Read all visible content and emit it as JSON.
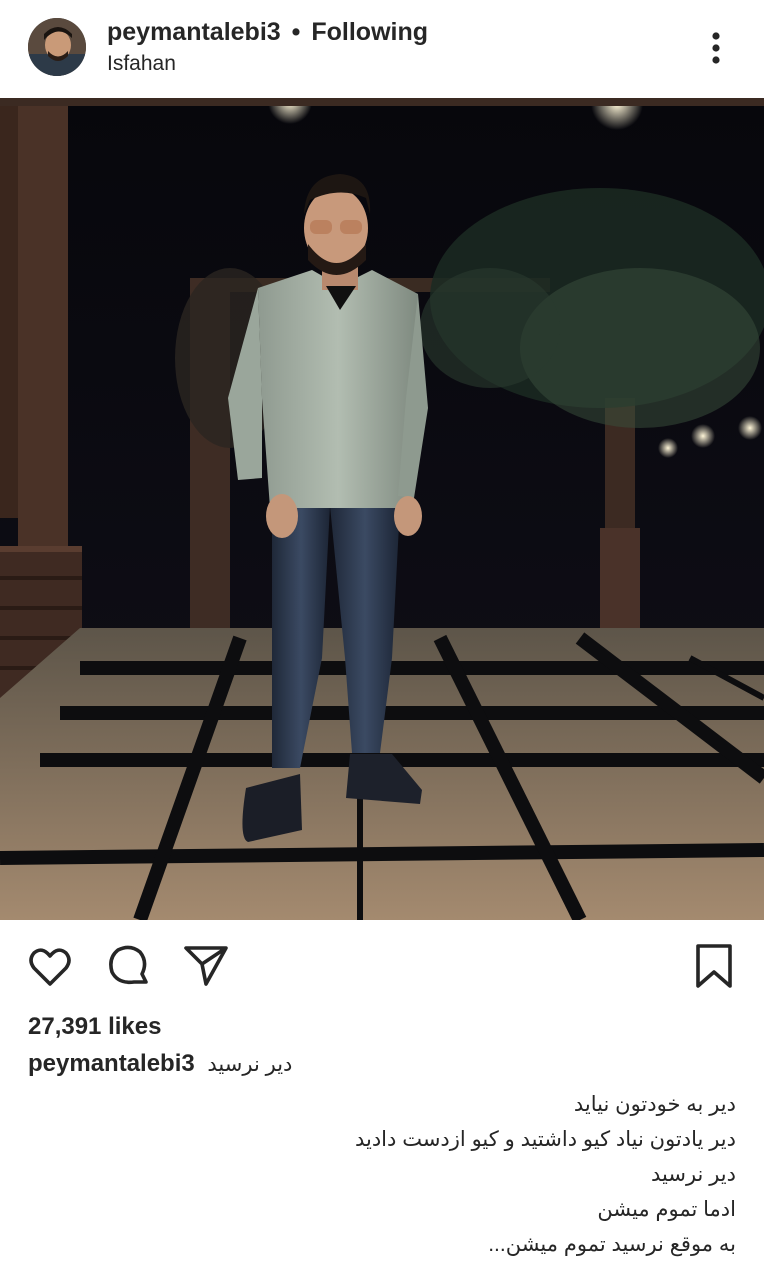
{
  "post": {
    "username": "peymantalebi3",
    "separator": "•",
    "follow_status": "Following",
    "location": "Isfahan",
    "likes_text": "27,391 likes",
    "caption_first": "دیر نرسید",
    "caption_lines": [
      "دیر به خودتون نیاید",
      "دیر یادتون نیاد کیو داشتید و کیو ازدست دادید",
      "دیر نرسید",
      "ادما تموم میشن",
      "به موقع نرسید تموم میشن..."
    ]
  },
  "icons": {
    "more": "more-vertical-icon",
    "like": "heart-icon",
    "comment": "comment-bubble-icon",
    "share": "paper-plane-icon",
    "save": "bookmark-icon"
  },
  "colors": {
    "text": "#262626",
    "background": "#ffffff"
  }
}
